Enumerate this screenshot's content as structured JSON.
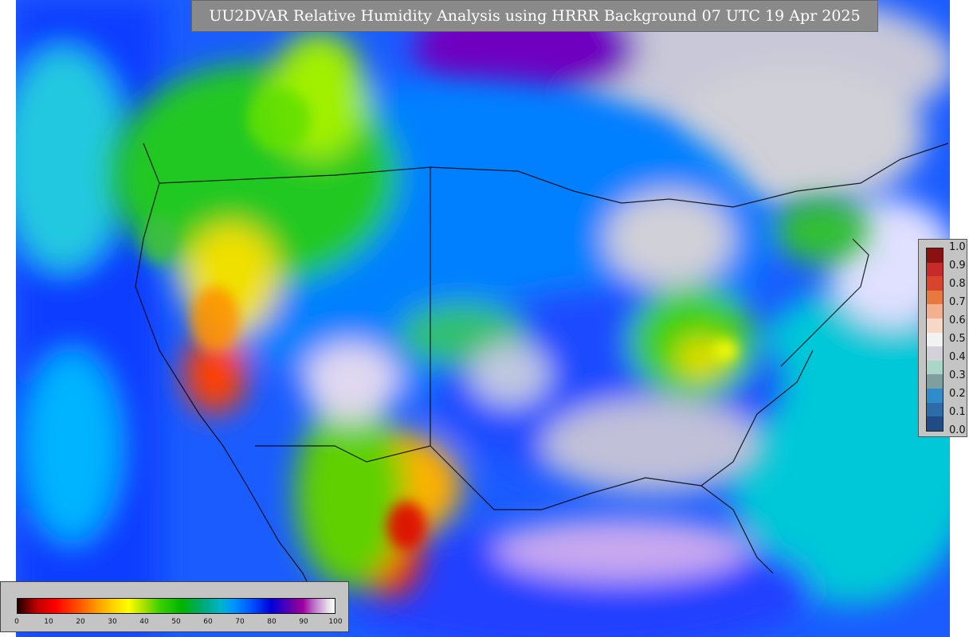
{
  "title": "UU2DVAR Relative Humidity Analysis using HRRR Background 07 UTC 19 Apr 2025",
  "station_legend": {
    "labels": [
      "1.0",
      "0.9",
      "0.8",
      "0.7",
      "0.6",
      "0.5",
      "0.4",
      "0.3",
      "0.2",
      "0.1",
      "0.0"
    ],
    "colors": [
      "#8b1010",
      "#c62a2a",
      "#d9452c",
      "#e8793e",
      "#f2b08e",
      "#f7d7c6",
      "#f2f2f2",
      "#d2d2d8",
      "#a9d6c6",
      "#7f9f9f",
      "#2f8cc8",
      "#2c6ca8",
      "#1f4c84"
    ]
  },
  "colorbar": {
    "ticks": [
      "0",
      "10",
      "20",
      "30",
      "40",
      "50",
      "60",
      "70",
      "80",
      "90",
      "100"
    ]
  }
}
